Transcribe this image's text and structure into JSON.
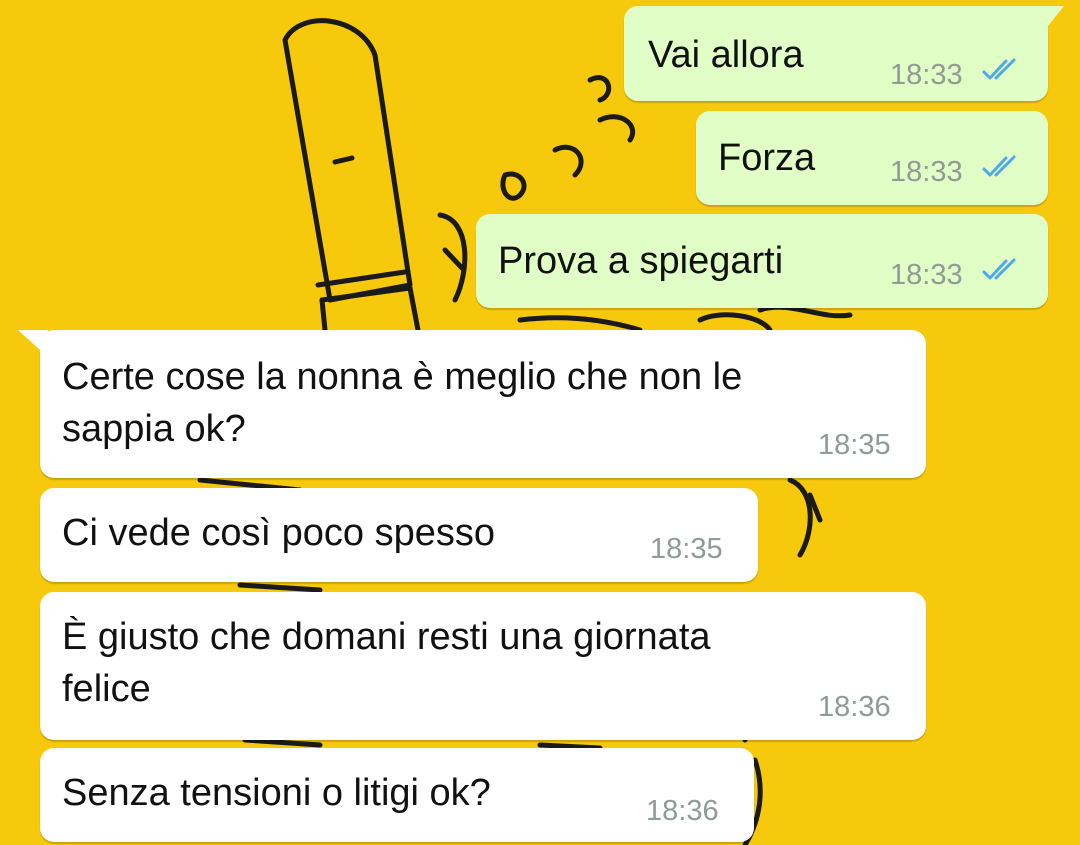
{
  "chat": {
    "sent": [
      {
        "text": "Vai allora",
        "time": "18:33",
        "status_icon": "double-check-read-icon"
      },
      {
        "text": "Forza",
        "time": "18:33",
        "status_icon": "double-check-read-icon"
      },
      {
        "text": "Prova a spiegarti",
        "time": "18:33",
        "status_icon": "double-check-read-icon"
      }
    ],
    "received": [
      {
        "line1": "Certe cose la nonna è meglio che non le",
        "line2": "sappia ok?",
        "time": "18:35"
      },
      {
        "text": "Ci vede così poco spesso",
        "time": "18:35"
      },
      {
        "line1": "È giusto che domani resti una giornata",
        "line2": "felice",
        "time": "18:36"
      },
      {
        "text": "Senza tensioni o litigi ok?",
        "time": "18:36"
      }
    ]
  },
  "colors": {
    "wallpaper": "#f7c90c",
    "sent_bubble": "#e1fec6",
    "received_bubble": "#ffffff",
    "read_ticks": "#4fa8e8",
    "time_text": "#8f9b94"
  }
}
